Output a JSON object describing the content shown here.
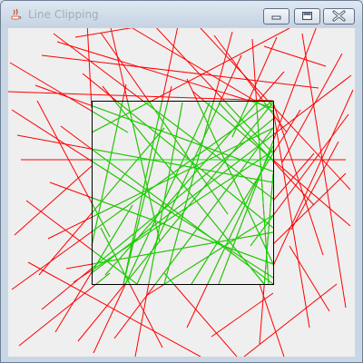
{
  "window": {
    "title": "Line Clipping",
    "controls": {
      "minimize_icon": "minimize-icon",
      "maximize_icon": "maximize-icon",
      "close_icon": "close-icon"
    }
  },
  "colors": {
    "outside": "#ff0000",
    "inside": "#00e000",
    "clip_border": "#000000",
    "background": "#efefef"
  },
  "clip_window": {
    "xmin": 100,
    "ymin": 110,
    "xmax": 300,
    "ymax": 312
  },
  "lines": [
    [
      10,
      68,
      140,
      145
    ],
    [
      38,
      93,
      300,
      188
    ],
    [
      58,
      36,
      300,
      218
    ],
    [
      45,
      60,
      350,
      96
    ],
    [
      62,
      45,
      300,
      118
    ],
    [
      82,
      40,
      190,
      22
    ],
    [
      95,
      24,
      100,
      118
    ],
    [
      110,
      35,
      250,
      235
    ],
    [
      120,
      25,
      175,
      265
    ],
    [
      145,
      30,
      300,
      122
    ],
    [
      168,
      26,
      300,
      168
    ],
    [
      196,
      23,
      135,
      312
    ],
    [
      220,
      30,
      385,
      208
    ],
    [
      235,
      38,
      315,
      145
    ],
    [
      255,
      34,
      180,
      312
    ],
    [
      277,
      42,
      295,
      312
    ],
    [
      290,
      50,
      358,
      72
    ],
    [
      304,
      40,
      255,
      150
    ],
    [
      318,
      30,
      100,
      145
    ],
    [
      332,
      36,
      380,
      338
    ],
    [
      348,
      28,
      240,
      312
    ],
    [
      376,
      58,
      310,
      178
    ],
    [
      386,
      82,
      100,
      300
    ],
    [
      383,
      125,
      275,
      270
    ],
    [
      380,
      190,
      300,
      268
    ],
    [
      385,
      248,
      212,
      100
    ],
    [
      370,
      312,
      268,
      392
    ],
    [
      12,
      120,
      300,
      305
    ],
    [
      18,
      148,
      300,
      200
    ],
    [
      22,
      175,
      380,
      175
    ],
    [
      28,
      220,
      150,
      312
    ],
    [
      15,
      258,
      100,
      182
    ],
    [
      12,
      318,
      300,
      110
    ],
    [
      30,
      288,
      220,
      392
    ],
    [
      20,
      380,
      120,
      300
    ],
    [
      45,
      340,
      300,
      130
    ],
    [
      60,
      365,
      145,
      225
    ],
    [
      72,
      295,
      300,
      255
    ],
    [
      85,
      375,
      300,
      112
    ],
    [
      102,
      388,
      230,
      112
    ],
    [
      125,
      372,
      300,
      140
    ],
    [
      148,
      392,
      200,
      112
    ],
    [
      160,
      325,
      300,
      236
    ],
    [
      178,
      382,
      110,
      250
    ],
    [
      205,
      360,
      300,
      160
    ],
    [
      232,
      370,
      300,
      322
    ],
    [
      260,
      392,
      180,
      300
    ],
    [
      285,
      378,
      300,
      190
    ],
    [
      312,
      392,
      285,
      312
    ],
    [
      340,
      360,
      300,
      120
    ],
    [
      362,
      342,
      318,
      270
    ],
    [
      355,
      280,
      300,
      112
    ],
    [
      345,
      168,
      300,
      220
    ],
    [
      330,
      120,
      210,
      312
    ],
    [
      372,
      155,
      320,
      252
    ],
    [
      388,
      98,
      300,
      292
    ],
    [
      345,
      225,
      240,
      112
    ],
    [
      54,
      200,
      300,
      290
    ],
    [
      66,
      138,
      300,
      312
    ],
    [
      90,
      80,
      300,
      250
    ],
    [
      112,
      94,
      290,
      312
    ],
    [
      138,
      92,
      100,
      270
    ],
    [
      188,
      94,
      135,
      312
    ],
    [
      205,
      86,
      300,
      290
    ],
    [
      265,
      60,
      150,
      312
    ],
    [
      312,
      78,
      115,
      302
    ],
    [
      8,
      100,
      300,
      110
    ],
    [
      80,
      310,
      300,
      165
    ],
    [
      52,
      262,
      300,
      140
    ],
    [
      42,
      302,
      180,
      140
    ],
    [
      40,
      110,
      120,
      260
    ]
  ]
}
